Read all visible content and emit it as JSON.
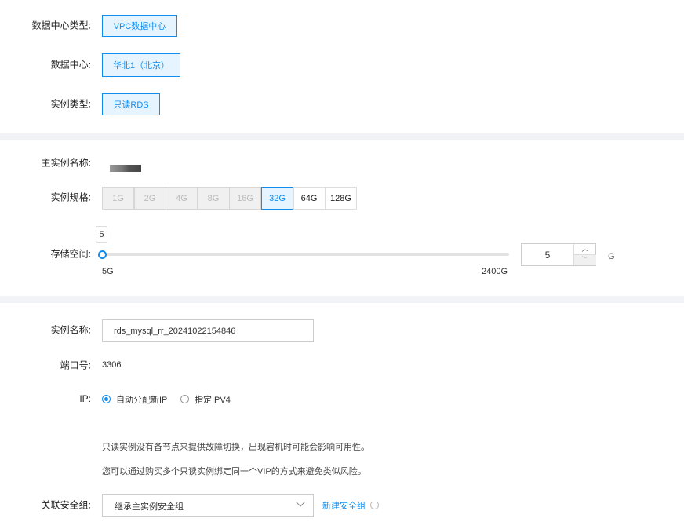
{
  "datacenter_type": {
    "label": "数据中心类型:",
    "value": "VPC数据中心"
  },
  "datacenter": {
    "label": "数据中心:",
    "value": "华北1（北京）"
  },
  "instance_type": {
    "label": "实例类型:",
    "value": "只读RDS"
  },
  "master_name": {
    "label": "主实例名称:"
  },
  "spec": {
    "label": "实例规格:",
    "options": [
      {
        "label": "1G",
        "state": "disabled"
      },
      {
        "label": "2G",
        "state": "disabled"
      },
      {
        "label": "4G",
        "state": "disabled"
      },
      {
        "label": "8G",
        "state": "disabled"
      },
      {
        "label": "16G",
        "state": "disabled"
      },
      {
        "label": "32G",
        "state": "selected"
      },
      {
        "label": "64G",
        "state": "enabled"
      },
      {
        "label": "128G",
        "state": "enabled"
      }
    ]
  },
  "storage": {
    "label": "存储空间:",
    "tooltip": "5",
    "min_label": "5G",
    "max_label": "2400G",
    "min": 5,
    "max": 2400,
    "value": "5",
    "unit": "G"
  },
  "instance_name": {
    "label": "实例名称:",
    "value": "rds_mysql_rr_20241022154846"
  },
  "port": {
    "label": "端口号:",
    "value": "3306"
  },
  "ip": {
    "label": "IP:",
    "options": [
      {
        "label": "自动分配新IP",
        "checked": true
      },
      {
        "label": "指定IPV4",
        "checked": false
      }
    ]
  },
  "notes": [
    "只读实例没有备节点来提供故障切换，出现宕机时可能会影响可用性。",
    "您可以通过购买多个只读实例绑定同一个VIP的方式来避免类似风险。"
  ],
  "security_group": {
    "label": "关联安全组:",
    "value": "继承主实例安全组",
    "new_link": "新建安全组"
  },
  "colors": {
    "accent": "#108cee"
  }
}
